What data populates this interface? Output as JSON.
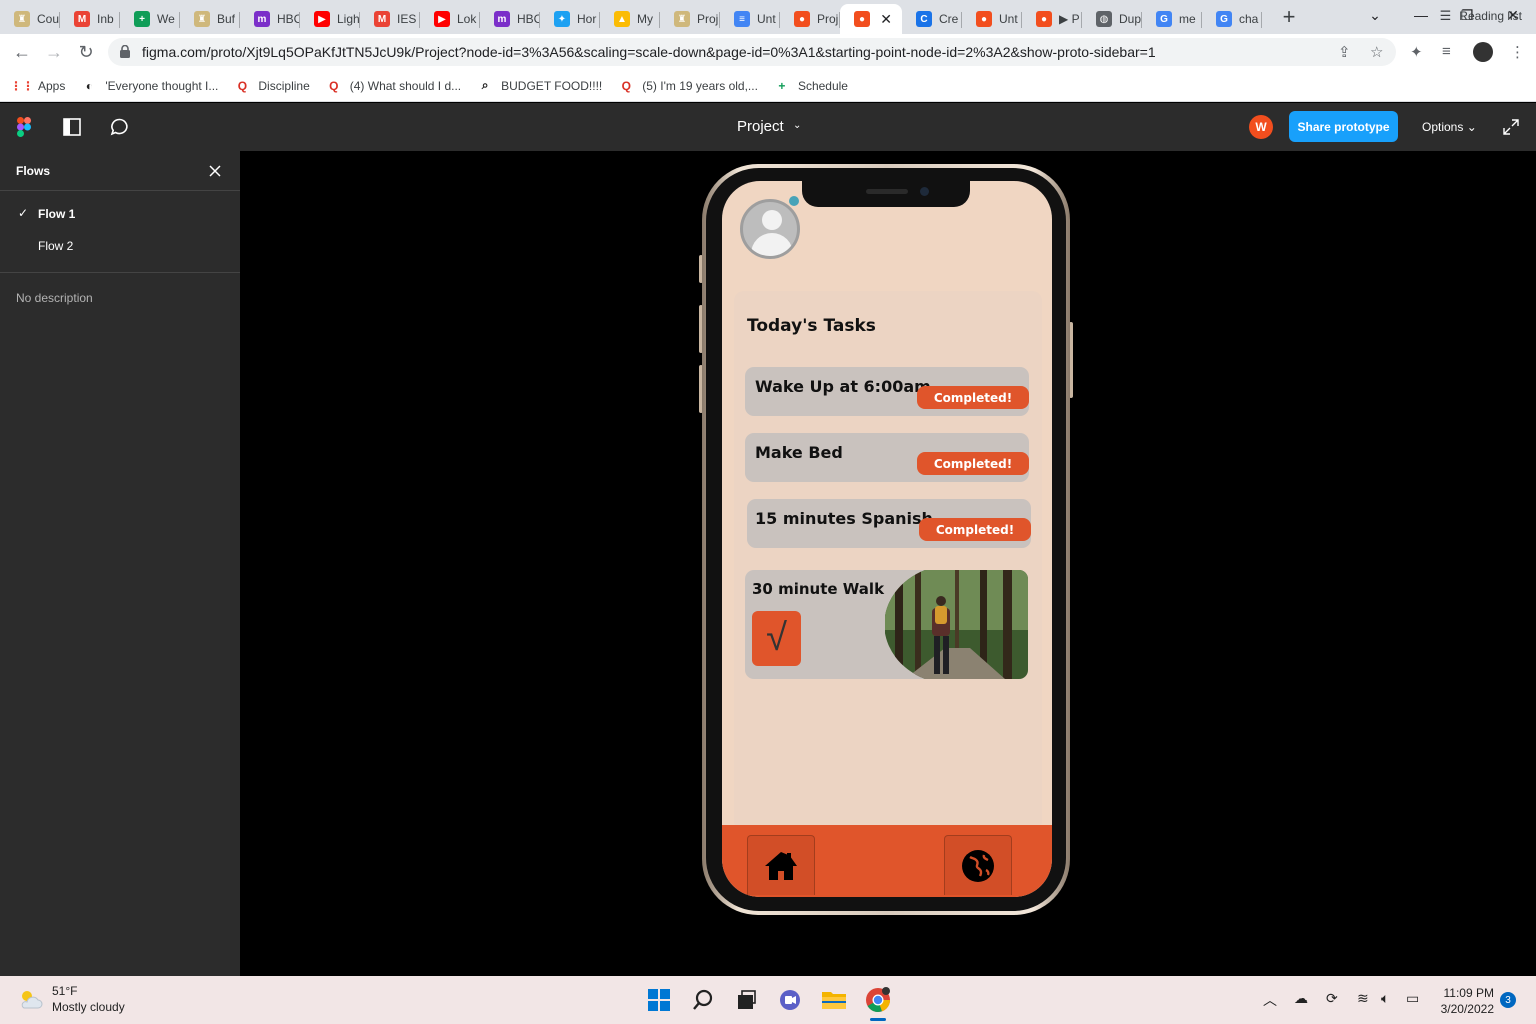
{
  "browser": {
    "tabs": [
      {
        "label": "Cou",
        "icon": "cu-icon",
        "color": "#cfb87c"
      },
      {
        "label": "Inb",
        "icon": "gmail-icon",
        "color": "#ea4335"
      },
      {
        "label": "We",
        "icon": "sheets-icon",
        "color": "#0f9d58"
      },
      {
        "label": "Buf",
        "icon": "cu-icon",
        "color": "#cfb87c"
      },
      {
        "label": "HBC",
        "icon": "hbo-icon",
        "color": "#7b2fc9"
      },
      {
        "label": "Ligh",
        "icon": "youtube-icon",
        "color": "#ff0000"
      },
      {
        "label": "IES",
        "icon": "gmail-icon",
        "color": "#ea4335"
      },
      {
        "label": "Lok",
        "icon": "youtube-icon",
        "color": "#ff0000"
      },
      {
        "label": "HBC",
        "icon": "hbo-icon",
        "color": "#7b2fc9"
      },
      {
        "label": "Hor",
        "icon": "twitter-icon",
        "color": "#1da1f2"
      },
      {
        "label": "My",
        "icon": "drive-icon",
        "color": "#fbbc04"
      },
      {
        "label": "Proj",
        "icon": "cu-icon",
        "color": "#cfb87c"
      },
      {
        "label": "Unt",
        "icon": "docs-icon",
        "color": "#4285f4"
      },
      {
        "label": "Proj",
        "icon": "figma-icon",
        "color": "#f24e1e"
      },
      {
        "label": "",
        "icon": "figma-icon",
        "color": "#f24e1e",
        "active": true
      },
      {
        "label": "Cre",
        "icon": "chrome-c-icon",
        "color": "#1a73e8"
      },
      {
        "label": "Unt",
        "icon": "figma-icon",
        "color": "#f24e1e"
      },
      {
        "label": "▶ P",
        "icon": "figma-icon",
        "color": "#f24e1e"
      },
      {
        "label": "Dup",
        "icon": "globe-icon",
        "color": "#5f6368"
      },
      {
        "label": "me",
        "icon": "google-icon",
        "color": "#4285f4"
      },
      {
        "label": "cha",
        "icon": "google-icon",
        "color": "#4285f4"
      }
    ],
    "url": "figma.com/proto/Xjt9Lq5OPaKfJtTN5JcU9k/Project?node-id=3%3A56&scaling=scale-down&page-id=0%3A1&starting-point-node-id=2%3A2&show-proto-sidebar=1",
    "bookmarks": [
      {
        "label": "Apps",
        "icon": "apps-grid-icon"
      },
      {
        "label": "'Everyone thought I...",
        "icon": "goodreads-icon"
      },
      {
        "label": "Discipline",
        "icon": "quora-icon"
      },
      {
        "label": "(4) What should I d...",
        "icon": "quora-icon"
      },
      {
        "label": "BUDGET FOOD!!!!",
        "icon": "search-lens-icon"
      },
      {
        "label": "(5) I'm 19 years old,...",
        "icon": "quora-icon"
      },
      {
        "label": "Schedule",
        "icon": "sheets-icon"
      }
    ],
    "reading_list": "Reading list"
  },
  "figma": {
    "project_title": "Project",
    "share_label": "Share prototype",
    "options_label": "Options",
    "user_initial": "W",
    "user_color": "#f24e1e",
    "share_color": "#18a0fb"
  },
  "sidebar": {
    "heading": "Flows",
    "flows": [
      {
        "label": "Flow 1",
        "selected": true
      },
      {
        "label": "Flow 2",
        "selected": false
      }
    ],
    "description": "No description"
  },
  "app": {
    "title": "Today's Tasks",
    "accent": "#e0552b",
    "tasks": [
      {
        "label": "Wake Up at 6:00am",
        "status": "Completed!"
      },
      {
        "label": "Make Bed",
        "status": "Completed!"
      },
      {
        "label": "15 minutes Spanish",
        "status": "Completed!"
      }
    ],
    "featured_task": {
      "label": "30 minute Walk",
      "check": "√"
    },
    "nav": [
      {
        "icon": "home-icon"
      },
      {
        "icon": "globe-icon"
      }
    ]
  },
  "taskbar": {
    "temperature": "51°F",
    "condition": "Mostly cloudy",
    "time": "11:09 PM",
    "date": "3/20/2022",
    "notifications": "3"
  }
}
